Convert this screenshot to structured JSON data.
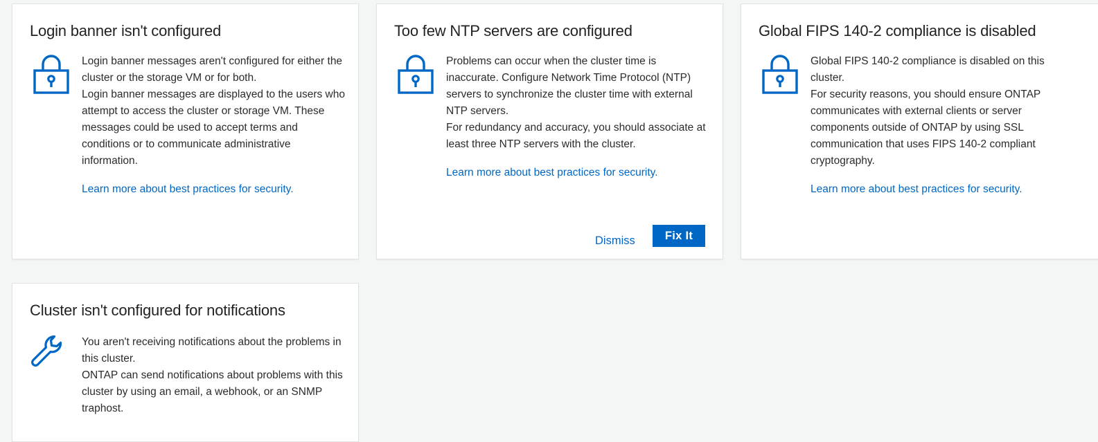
{
  "colors": {
    "accent": "#0067c5",
    "page_background": "#f3f6f4",
    "card_background": "#ffffff"
  },
  "cards": [
    {
      "title": "Login banner isn't configured",
      "icon": "lock-icon",
      "paragraphs": [
        "Login banner messages aren't configured for either the cluster or the storage VM or for both.",
        "Login banner messages are displayed to the users who attempt to access the cluster or storage VM. These messages could be used to accept terms and conditions or to communicate administrative information."
      ],
      "link": "Learn more about best practices for security."
    },
    {
      "title": "Too few NTP servers are configured",
      "icon": "lock-icon",
      "paragraphs": [
        "Problems can occur when the cluster time is inaccurate. Configure Network Time Protocol (NTP) servers to synchronize the cluster time with external NTP servers.",
        "For redundancy and accuracy, you should associate at least three NTP servers with the cluster."
      ],
      "link": "Learn more about best practices for security.",
      "dismiss_label": "Dismiss",
      "fix_label": "Fix It"
    },
    {
      "title": "Global FIPS 140-2 compliance is disabled",
      "icon": "lock-icon",
      "paragraphs": [
        "Global FIPS 140-2 compliance is disabled on this cluster.",
        "For security reasons, you should ensure ONTAP communicates with external clients or server components outside of ONTAP by using SSL communication that uses FIPS 140-2 compliant cryptography."
      ],
      "link": "Learn more about best practices for security."
    },
    {
      "title": "Cluster isn't configured for notifications",
      "icon": "wrench-icon",
      "paragraphs": [
        "You aren't receiving notifications about the problems in this cluster.",
        "ONTAP can send notifications about problems with this cluster by using an email, a webhook, or an SNMP traphost."
      ]
    }
  ]
}
